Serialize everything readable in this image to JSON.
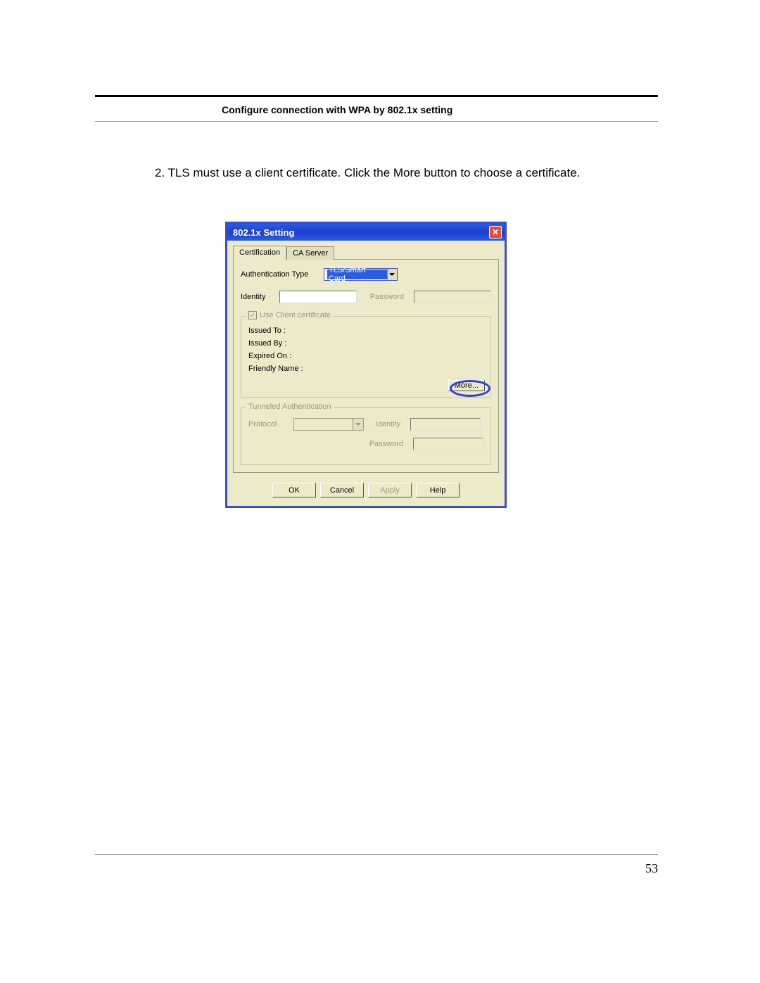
{
  "header": {
    "section_title": "Configure connection with WPA by 802.1x setting"
  },
  "body": {
    "step_text": "2. TLS must use a client certificate. Click the More button to choose a certificate."
  },
  "dialog": {
    "title": "802.1x Setting",
    "tabs": {
      "certification": "Certification",
      "ca_server": "CA Server"
    },
    "auth_type_label": "Authentication Type",
    "auth_type_value": "TLS/Smart Card",
    "identity_label": "Identity",
    "identity_value": "",
    "password_label": "Password",
    "password_value": "",
    "cert_group": {
      "legend": "Use Client certificate",
      "issued_to": "Issued To :",
      "issued_by": "Issued By :",
      "expired_on": "Expired On :",
      "friendly_name": "Friendly Name :",
      "more_button": "More..."
    },
    "tunnel_group": {
      "legend": "Tunneled Authentication",
      "protocol_label": "Protocol",
      "identity_label": "Identity",
      "password_label": "Password"
    },
    "buttons": {
      "ok": "OK",
      "cancel": "Cancel",
      "apply": "Apply",
      "help": "Help"
    }
  },
  "footer": {
    "page_number": "53"
  }
}
